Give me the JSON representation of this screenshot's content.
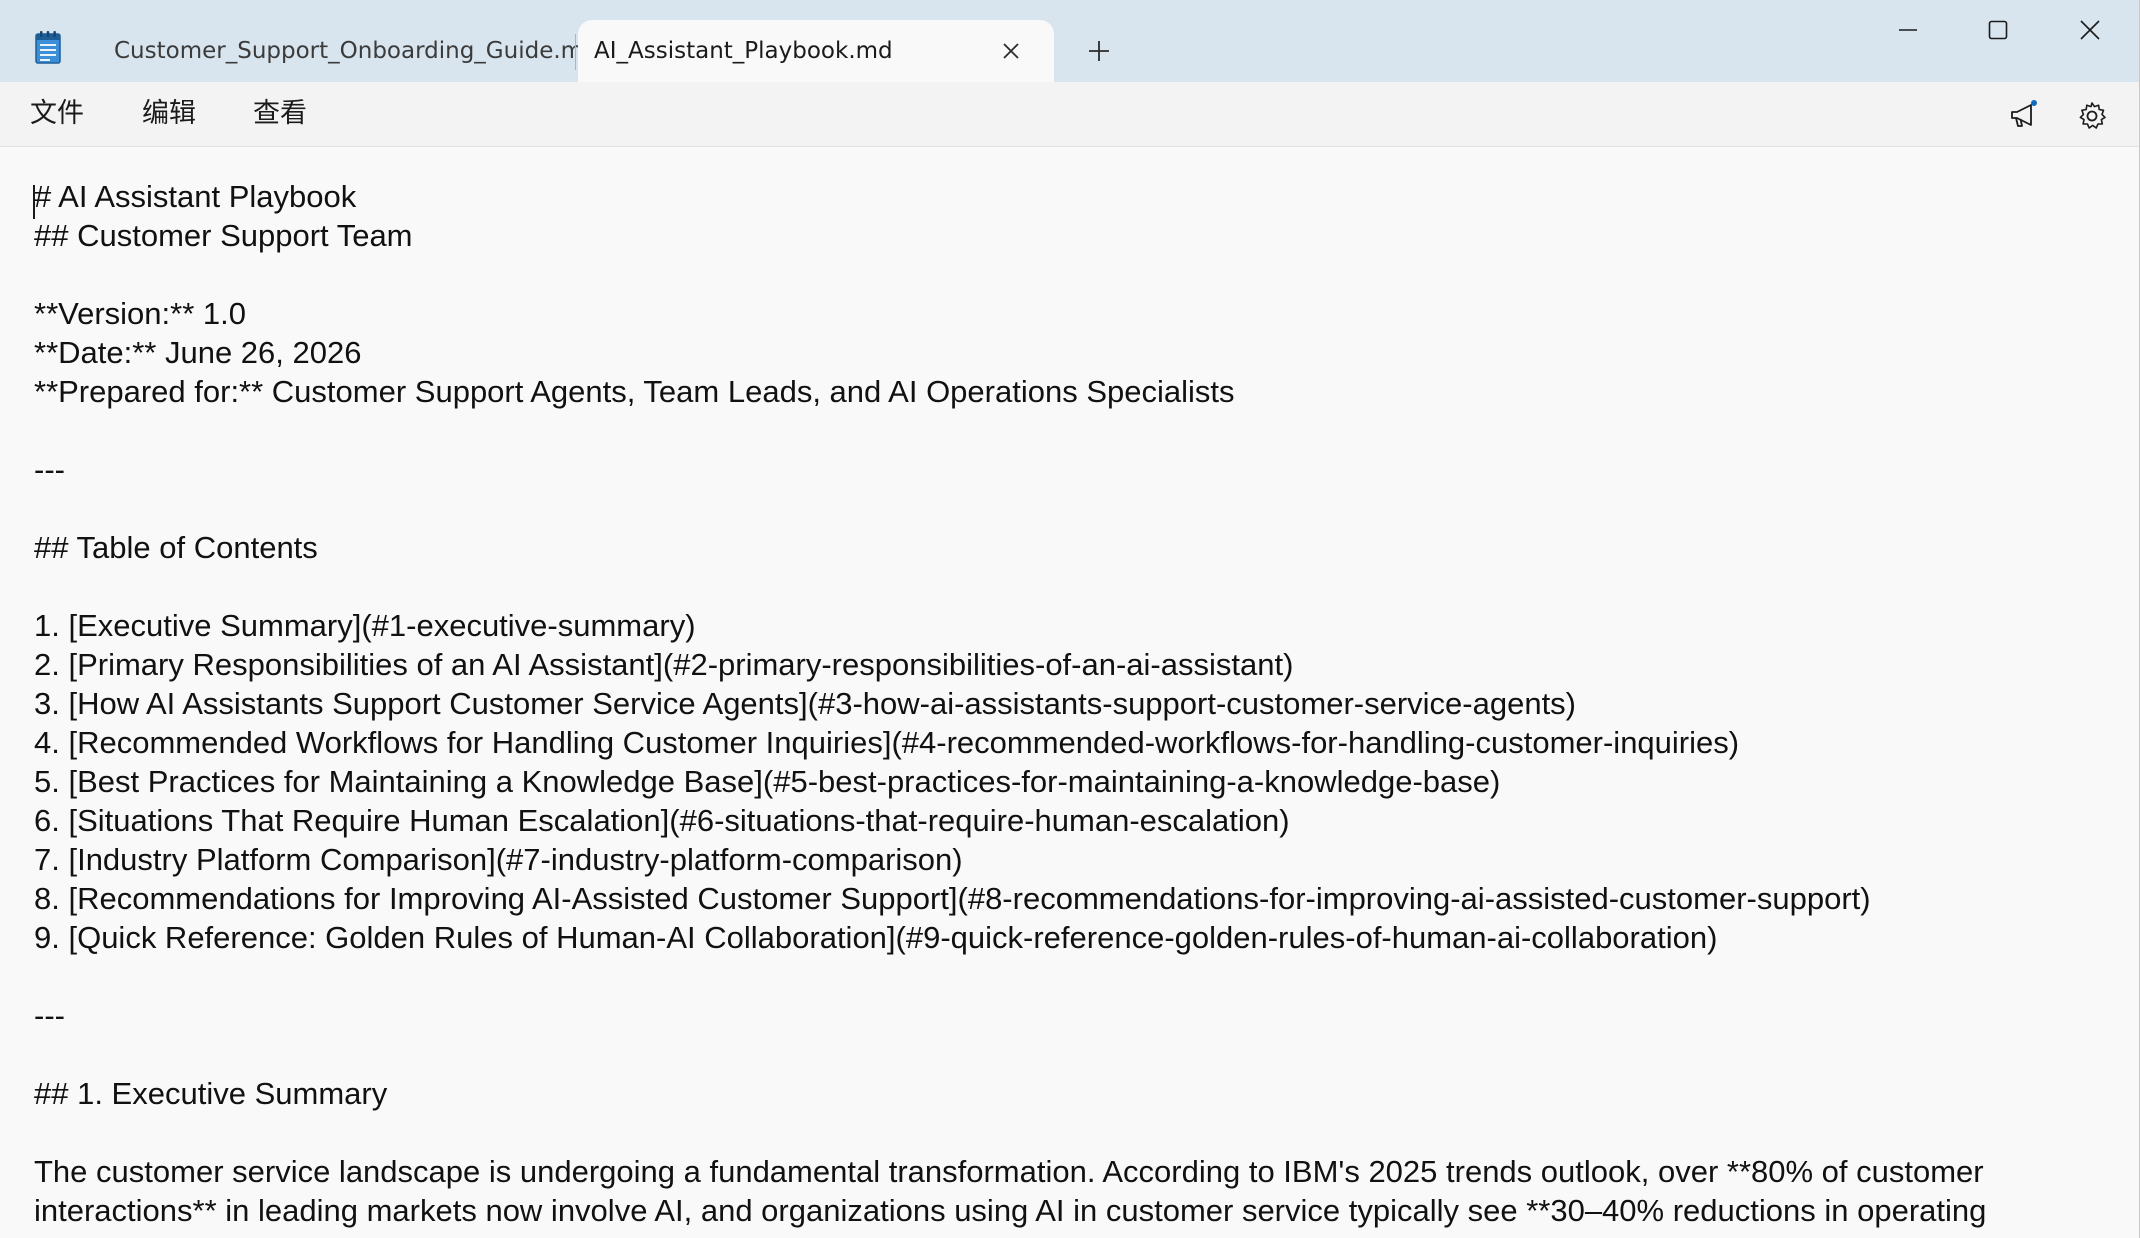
{
  "tabs": {
    "inactive_label": "Customer_Support_Onboarding_Guide.md",
    "active_label": "AI_Assistant_Playbook.md",
    "new_tab_icon": "plus-icon",
    "close_icon": "close-icon"
  },
  "app_icon": "notepad-icon",
  "window_controls": {
    "minimize_icon": "minimize-icon",
    "maximize_icon": "maximize-icon",
    "close_icon": "close-icon"
  },
  "menu": {
    "file": "文件",
    "edit": "编辑",
    "view": "查看"
  },
  "toolbar": {
    "announce_icon": "megaphone-icon",
    "settings_icon": "gear-icon"
  },
  "colors": {
    "titlebar_bg": "#d8e5ee",
    "editor_bg": "#f9f9f9",
    "notification_dot": "#0f6cbd"
  },
  "document": {
    "lines": [
      "# AI Assistant Playbook",
      "## Customer Support Team",
      "",
      "**Version:** 1.0",
      "**Date:** June 26, 2026",
      "**Prepared for:** Customer Support Agents, Team Leads, and AI Operations Specialists",
      "",
      "---",
      "",
      "## Table of Contents",
      "",
      "1. [Executive Summary](#1-executive-summary)",
      "2. [Primary Responsibilities of an AI Assistant](#2-primary-responsibilities-of-an-ai-assistant)",
      "3. [How AI Assistants Support Customer Service Agents](#3-how-ai-assistants-support-customer-service-agents)",
      "4. [Recommended Workflows for Handling Customer Inquiries](#4-recommended-workflows-for-handling-customer-inquiries)",
      "5. [Best Practices for Maintaining a Knowledge Base](#5-best-practices-for-maintaining-a-knowledge-base)",
      "6. [Situations That Require Human Escalation](#6-situations-that-require-human-escalation)",
      "7. [Industry Platform Comparison](#7-industry-platform-comparison)",
      "8. [Recommendations for Improving AI-Assisted Customer Support](#8-recommendations-for-improving-ai-assisted-customer-support)",
      "9. [Quick Reference: Golden Rules of Human-AI Collaboration](#9-quick-reference-golden-rules-of-human-ai-collaboration)",
      "",
      "---",
      "",
      "## 1. Executive Summary",
      "",
      "The customer service landscape is undergoing a fundamental transformation. According to IBM's 2025 trends outlook, over **80% of customer",
      "interactions** in leading markets now involve AI, and organizations using AI in customer service typically see **30–40% reductions in operating"
    ]
  }
}
